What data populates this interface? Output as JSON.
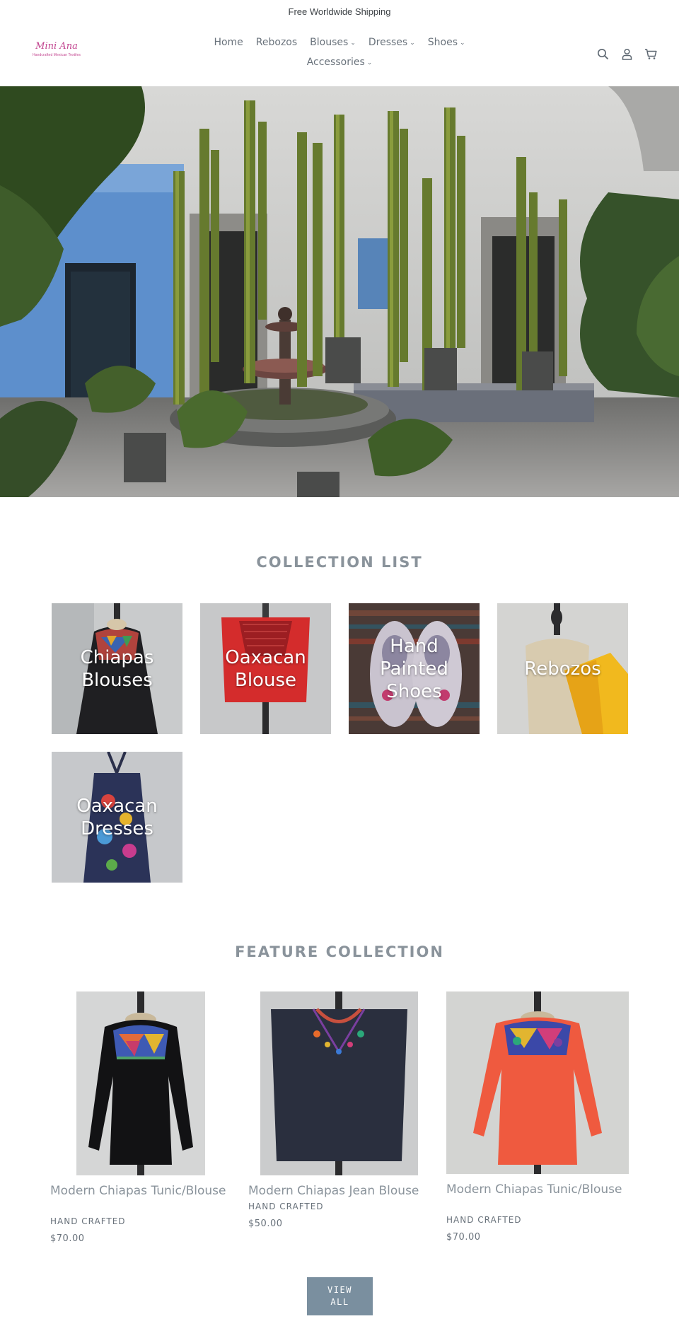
{
  "announcement": "Free Worldwide Shipping",
  "logo": {
    "script": "Mini Ana",
    "tagline": "Handcrafted Mexican Textiles"
  },
  "nav": [
    {
      "label": "Home",
      "dropdown": false
    },
    {
      "label": "Rebozos",
      "dropdown": false
    },
    {
      "label": "Blouses",
      "dropdown": true
    },
    {
      "label": "Dresses",
      "dropdown": true
    },
    {
      "label": "Shoes",
      "dropdown": true
    },
    {
      "label": "Accessories",
      "dropdown": true
    }
  ],
  "header_icons": [
    "search-icon",
    "account-icon",
    "cart-icon"
  ],
  "collection_list": {
    "title": "COLLECTION LIST",
    "items": [
      {
        "label": "Chiapas Blouses"
      },
      {
        "label": "Oaxacan Blouse"
      },
      {
        "label": "Hand Painted Shoes"
      },
      {
        "label": "Rebozos"
      },
      {
        "label": "Oaxacan Dresses"
      }
    ]
  },
  "feature_collection": {
    "title": "FEATURE COLLECTION",
    "products": [
      {
        "title": "Modern Chiapas Tunic/Blouse",
        "vendor": "HAND CRAFTED",
        "price": "$70.00"
      },
      {
        "title": "Modern Chiapas Jean Blouse",
        "vendor": "HAND CRAFTED",
        "price": "$50.00"
      },
      {
        "title": "Modern Chiapas Tunic/Blouse",
        "vendor": "HAND CRAFTED",
        "price": "$70.00"
      }
    ],
    "view_all": "VIEW ALL"
  },
  "colors": {
    "text": "#69727b",
    "title": "#8a939b",
    "button": "#7a8f9f",
    "logo": "#c2448f"
  }
}
